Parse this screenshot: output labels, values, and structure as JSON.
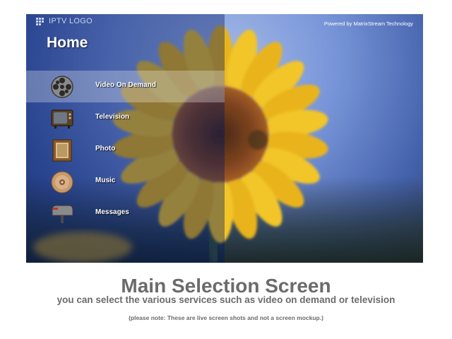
{
  "screen": {
    "logo_text": "IPTV LOGO",
    "powered_by": "Powered by MatrixStream Technology",
    "title": "Home"
  },
  "menu": {
    "selected_index": 0,
    "items": [
      {
        "label": "Video On Demand",
        "icon": "film-reel-icon"
      },
      {
        "label": "Television",
        "icon": "television-icon"
      },
      {
        "label": "Photo",
        "icon": "picture-frame-icon"
      },
      {
        "label": "Music",
        "icon": "compact-disc-icon"
      },
      {
        "label": "Messages",
        "icon": "mailbox-icon"
      }
    ]
  },
  "caption": {
    "title": "Main Selection Screen",
    "subtitle": "you can select the various services such as video on demand or television",
    "note": "(please note: These are live screen shots and not a screen mockup.)"
  },
  "colors": {
    "caption_text": "#6b6b6b",
    "panel_tint": "#142870",
    "sky": "#6f8ed6",
    "petal": "#f2c21a",
    "flower_center": "#7a3a12"
  }
}
